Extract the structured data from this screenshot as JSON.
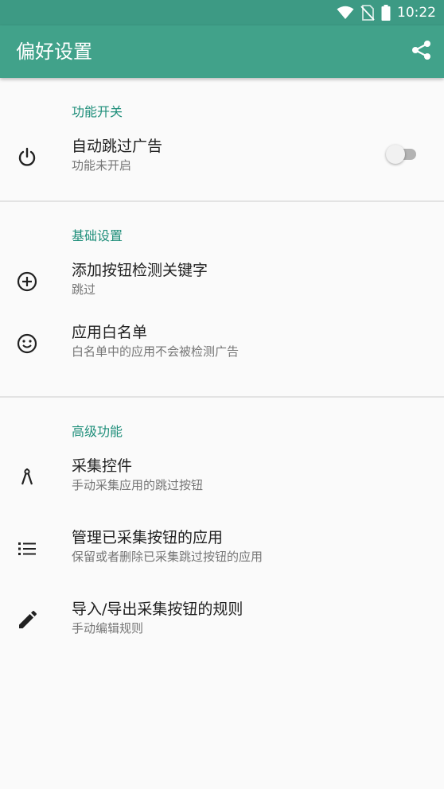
{
  "status_bar": {
    "time": "10:22",
    "icons": [
      "wifi-icon",
      "no-sim-icon",
      "battery-icon"
    ]
  },
  "app_bar": {
    "title": "偏好设置",
    "action_icon": "share-icon"
  },
  "sections": [
    {
      "header": "功能开关",
      "items": [
        {
          "icon": "power-icon",
          "title": "自动跳过广告",
          "summary": "功能未开启",
          "toggle": false
        }
      ]
    },
    {
      "header": "基础设置",
      "items": [
        {
          "icon": "add-circle-icon",
          "title": "添加按钮检测关键字",
          "summary": "跳过"
        },
        {
          "icon": "smiley-icon",
          "title": "应用白名单",
          "summary": "白名单中的应用不会被检测广告"
        }
      ]
    },
    {
      "header": "高级功能",
      "items": [
        {
          "icon": "compass-icon",
          "title": "采集控件",
          "summary": "手动采集应用的跳过按钮"
        },
        {
          "icon": "list-icon",
          "title": "管理已采集按钮的应用",
          "summary": "保留或者删除已采集跳过按钮的应用"
        },
        {
          "icon": "pencil-icon",
          "title": "导入/导出采集按钮的规则",
          "summary": "手动编辑规则"
        }
      ]
    }
  ],
  "colors": {
    "status_bar": "#3d9a84",
    "app_bar": "#41a28a",
    "section_header": "#1e8e7a",
    "background": "#fafafa"
  }
}
